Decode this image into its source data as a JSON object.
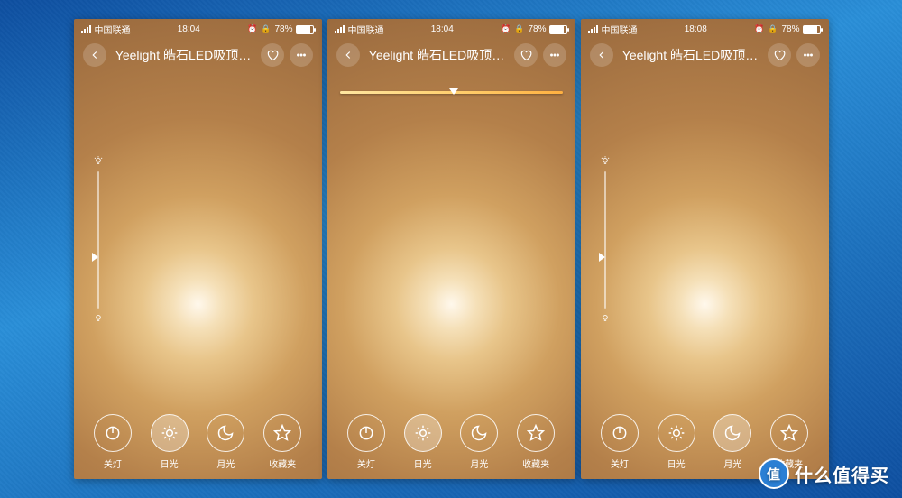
{
  "watermark": {
    "badge": "值",
    "text": "什么值得买"
  },
  "screens": [
    {
      "status": {
        "carrier": "中国联通",
        "time": "18:04",
        "battery": "78%"
      },
      "title": "Yeelight 皓石LED吸顶…",
      "show_color_slider": false,
      "show_bright_slider": true,
      "active_mode": 1,
      "modes": [
        {
          "key": "off",
          "label": "关灯"
        },
        {
          "key": "sun",
          "label": "日光"
        },
        {
          "key": "moon",
          "label": "月光"
        },
        {
          "key": "fav",
          "label": "收藏夹"
        }
      ]
    },
    {
      "status": {
        "carrier": "中国联通",
        "time": "18:04",
        "battery": "78%"
      },
      "title": "Yeelight 皓石LED吸顶…",
      "show_color_slider": true,
      "show_bright_slider": false,
      "active_mode": 1,
      "modes": [
        {
          "key": "off",
          "label": "关灯"
        },
        {
          "key": "sun",
          "label": "日光"
        },
        {
          "key": "moon",
          "label": "月光"
        },
        {
          "key": "fav",
          "label": "收藏夹"
        }
      ]
    },
    {
      "status": {
        "carrier": "中国联通",
        "time": "18:08",
        "battery": "78%"
      },
      "title": "Yeelight 皓石LED吸顶…",
      "show_color_slider": false,
      "show_bright_slider": true,
      "active_mode": 2,
      "modes": [
        {
          "key": "off",
          "label": "关灯"
        },
        {
          "key": "sun",
          "label": "日光"
        },
        {
          "key": "moon",
          "label": "月光"
        },
        {
          "key": "fav",
          "label": "收藏夹"
        }
      ]
    }
  ]
}
